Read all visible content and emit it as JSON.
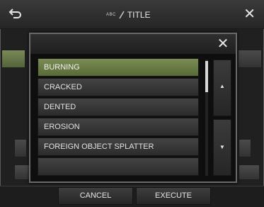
{
  "header": {
    "icon_label": "ABC",
    "title": "TITLE"
  },
  "dialog": {
    "items": [
      {
        "label": "BURNING",
        "selected": true
      },
      {
        "label": "CRACKED",
        "selected": false
      },
      {
        "label": "DENTED",
        "selected": false
      },
      {
        "label": "EROSION",
        "selected": false
      },
      {
        "label": "FOREIGN OBJECT SPLATTER",
        "selected": false
      },
      {
        "label": "",
        "selected": false
      }
    ]
  },
  "footer": {
    "cancel_label": "CANCEL",
    "execute_label": "EXECUTE"
  },
  "colors": {
    "selected": "#6a7b47",
    "background": "#202020"
  }
}
